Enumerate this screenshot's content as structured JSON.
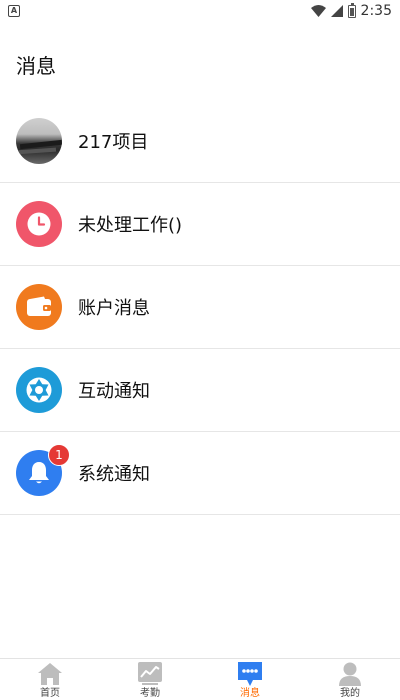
{
  "status_bar": {
    "notification_icon": "A",
    "time": "2:35"
  },
  "header": {
    "title": "消息"
  },
  "messages": {
    "items": [
      {
        "label": "217项目",
        "icon": "photo-avatar"
      },
      {
        "label": "未处理工作()",
        "icon": "clock-icon",
        "color": "#f0566a"
      },
      {
        "label": "账户消息",
        "icon": "wallet-icon",
        "color": "#f07a1e"
      },
      {
        "label": "互动通知",
        "icon": "aperture-icon",
        "color": "#1e9bd8"
      },
      {
        "label": "系统通知",
        "icon": "bell-icon",
        "color": "#2f7ef0",
        "badge": "1"
      }
    ]
  },
  "tab_bar": {
    "tabs": [
      {
        "label": "首页",
        "icon": "home-icon"
      },
      {
        "label": "考勤",
        "icon": "chart-icon"
      },
      {
        "label": "消息",
        "icon": "chat-icon",
        "active": true
      },
      {
        "label": "我的",
        "icon": "person-icon"
      }
    ]
  },
  "colors": {
    "accent": "#ff6a00",
    "active_tab_icon": "#2f7ef0",
    "inactive_icon": "#bdbdbd",
    "badge": "#e53935"
  }
}
